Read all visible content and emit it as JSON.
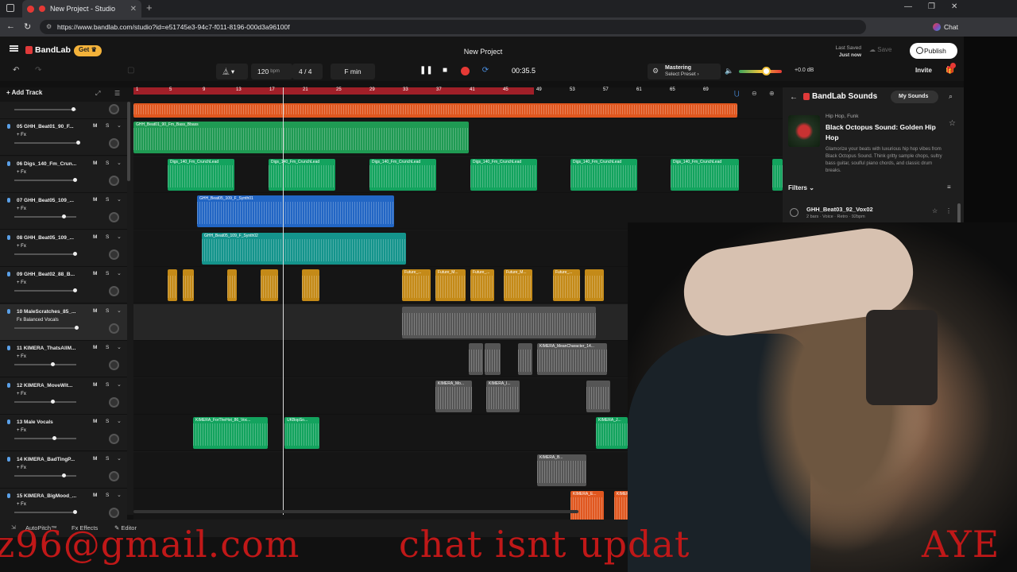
{
  "browser": {
    "tab_title": "New Project - Studio",
    "url": "https://www.bandlab.com/studio?id=e51745e3-94c7-f011-8196-000d3a96100f",
    "chat_label": "Chat"
  },
  "header": {
    "brand": "BandLab",
    "get_label": "Get",
    "project_title": "New Project",
    "last_saved_label": "Last Saved",
    "last_saved_value": "Just now",
    "save_label": "Save",
    "publish_label": "Publish"
  },
  "transport": {
    "tempo": "120",
    "tempo_unit": "bpm",
    "time_signature": "4 / 4",
    "key": "F min",
    "time": "00:35.5",
    "mastering_label": "Mastering",
    "mastering_sub": "Select Preset ›",
    "volume_db": "+0.0 dB",
    "invite_label": "Invite"
  },
  "timeline": {
    "add_track_label": "Add Track",
    "ruler_ticks": [
      "1",
      "5",
      "9",
      "13",
      "17",
      "21",
      "25",
      "29",
      "33",
      "37",
      "41",
      "45",
      "49",
      "53",
      "57",
      "61",
      "65",
      "69"
    ]
  },
  "tracks": [
    {
      "num": "05",
      "name": "GHH_Beat01_90_F...",
      "fx": "+ Fx"
    },
    {
      "num": "06",
      "name": "Digs_140_Fm_Crun...",
      "fx": "+ Fx"
    },
    {
      "num": "07",
      "name": "GHH_Beat05_109_...",
      "fx": "+ Fx"
    },
    {
      "num": "08",
      "name": "GHH_Beat05_109_...",
      "fx": "+ Fx"
    },
    {
      "num": "09",
      "name": "GHH_Beat02_88_B...",
      "fx": "+ Fx"
    },
    {
      "num": "10",
      "name": "MaleScratches_85_...",
      "fx": "Fx Balanced Vocals"
    },
    {
      "num": "11",
      "name": "KIMERA_ThatsAllM...",
      "fx": "+ Fx"
    },
    {
      "num": "12",
      "name": "KIMERA_MoveWit...",
      "fx": "+ Fx"
    },
    {
      "num": "13",
      "name": "Male Vocals",
      "fx": "+ Fx"
    },
    {
      "num": "14",
      "name": "KIMERA_BadTingP...",
      "fx": "+ Fx"
    },
    {
      "num": "15",
      "name": "KIMERA_BigMood_...",
      "fx": "+ Fx"
    }
  ],
  "mute_label": "M",
  "solo_label": "S",
  "clips": {
    "bass": "GHH_Beat01_90_Fm_Bass_Bbass",
    "crunch": "Digs_140_Fm_CrunchLead",
    "synth01": "GHH_Beat05_109_F_Synth01",
    "synth02": "GHH_Beat05_109_F_Synth02",
    "future": "Future_...",
    "future2": "Future_M...",
    "mean": "KIMERA_MeanCharacter_14...",
    "kimera_mo": "KIMERA_Mo...",
    "kimera_i": "KIMERA_I...",
    "vocals": "KIMERA_ForTheHot_86_Voc...",
    "ukbop": "UKBopSo...",
    "kimera_j": "KIMERA_J...",
    "kimera_b": "KIMERA_B...",
    "kimera_e": "KIMERA_E..."
  },
  "bottom": {
    "autopitch": "AutoPitch™",
    "effects": "Effects",
    "editor": "Editor"
  },
  "panel": {
    "title": "BandLab Sounds",
    "my_sounds": "My Sounds",
    "pack_genre": "Hip Hop, Funk",
    "pack_name": "Black Octopus Sound: Golden Hip Hop",
    "pack_desc": "Glamorize your beats with luxurious hip hop vibes from Black Octopus Sound. Think gritty sample chops, sultry bass guitar, soulful piano chords, and classic drum breaks.",
    "filters_label": "Filters",
    "sounds": [
      {
        "name": "GHH_Beat03_92_Vox02",
        "meta": "2 bars · Voice · Retro · 92bpm"
      }
    ]
  },
  "overlay": {
    "left_text": "z96@gmail.com",
    "right_text": "chat isnt updat",
    "far_text": "AYE"
  }
}
